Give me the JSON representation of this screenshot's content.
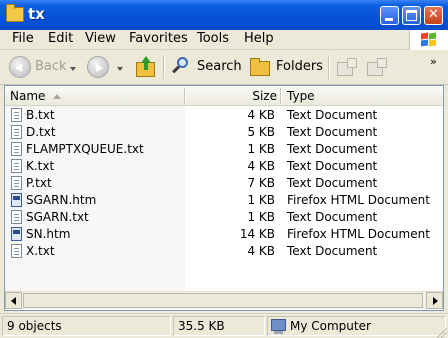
{
  "window": {
    "title": "tx"
  },
  "menu": {
    "items": [
      "File",
      "Edit",
      "View",
      "Favorites",
      "Tools",
      "Help"
    ]
  },
  "toolbar": {
    "back_label": "Back",
    "search_label": "Search",
    "folders_label": "Folders"
  },
  "list": {
    "columns": {
      "name": "Name",
      "size": "Size",
      "type": "Type"
    },
    "rows": [
      {
        "name": "B.txt",
        "size": "4 KB",
        "type": "Text Document",
        "icon": "text-file-icon"
      },
      {
        "name": "D.txt",
        "size": "5 KB",
        "type": "Text Document",
        "icon": "text-file-icon"
      },
      {
        "name": "FLAMPTXQUEUE.txt",
        "size": "1 KB",
        "type": "Text Document",
        "icon": "text-file-icon"
      },
      {
        "name": "K.txt",
        "size": "4 KB",
        "type": "Text Document",
        "icon": "text-file-icon"
      },
      {
        "name": "P.txt",
        "size": "7 KB",
        "type": "Text Document",
        "icon": "text-file-icon"
      },
      {
        "name": "SGARN.htm",
        "size": "1 KB",
        "type": "Firefox HTML Document",
        "icon": "html-file-icon"
      },
      {
        "name": "SGARN.txt",
        "size": "1 KB",
        "type": "Text Document",
        "icon": "text-file-icon"
      },
      {
        "name": "SN.htm",
        "size": "14 KB",
        "type": "Firefox HTML Document",
        "icon": "html-file-icon"
      },
      {
        "name": "X.txt",
        "size": "4 KB",
        "type": "Text Document",
        "icon": "text-file-icon"
      }
    ]
  },
  "status": {
    "objects": "9 objects",
    "size": "35.5 KB",
    "location": "My Computer"
  }
}
